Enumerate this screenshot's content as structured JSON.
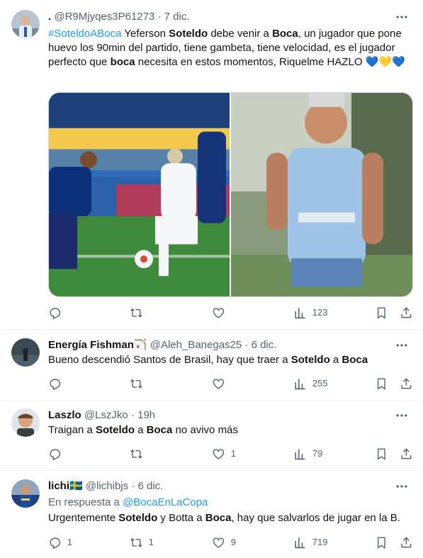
{
  "tweets": [
    {
      "name": ".",
      "handle": "@R9Mjyqes3P61273",
      "date": "7 dic.",
      "text_parts": [
        {
          "t": "#SoteldoABoca",
          "style": "link"
        },
        {
          "t": " Yeferson ",
          "style": "plain"
        },
        {
          "t": "Soteldo",
          "style": "bold"
        },
        {
          "t": " debe venir a ",
          "style": "plain"
        },
        {
          "t": "Boca",
          "style": "bold"
        },
        {
          "t": ", un jugador que pone huevo los 90min del partido, tiene gambeta, tiene velocidad, es el jugador perfecto que ",
          "style": "plain"
        },
        {
          "t": "boca",
          "style": "bold"
        },
        {
          "t": " necesita en estos momentos, Riquelme HAZLO ",
          "style": "plain"
        },
        {
          "t": "💙💛💙",
          "style": "emoji"
        }
      ],
      "replies": "",
      "retweets": "",
      "likes": "",
      "views": "123"
    },
    {
      "name": "Energía Fishman",
      "name_emoji": "🏹",
      "handle": "@Aleh_Banegas25",
      "date": "6 dic.",
      "text_parts": [
        {
          "t": "Bueno descendió Santos de Brasil, hay que traer a ",
          "style": "plain"
        },
        {
          "t": "Soteldo",
          "style": "bold"
        },
        {
          "t": " a ",
          "style": "plain"
        },
        {
          "t": "Boca",
          "style": "bold"
        }
      ],
      "replies": "",
      "retweets": "",
      "likes": "",
      "views": "255"
    },
    {
      "name": "Laszlo",
      "handle": "@LszJko",
      "date": "19h",
      "text_parts": [
        {
          "t": "Traigan a ",
          "style": "plain"
        },
        {
          "t": "Soteldo",
          "style": "bold"
        },
        {
          "t": " a ",
          "style": "plain"
        },
        {
          "t": "Boca",
          "style": "bold"
        },
        {
          "t": " no avivo más",
          "style": "plain"
        }
      ],
      "replies": "",
      "retweets": "",
      "likes": "1",
      "views": "79"
    },
    {
      "name": "lichi",
      "name_emoji": "🇸🇪",
      "handle": "@lichibjs",
      "date": "6 dic.",
      "reply_prefix": "En respuesta a ",
      "reply_to": "@BocaEnLaCopa",
      "text_parts": [
        {
          "t": "Urgentemente ",
          "style": "plain"
        },
        {
          "t": "Soteldo",
          "style": "bold"
        },
        {
          "t": " y Botta a ",
          "style": "plain"
        },
        {
          "t": "Boca",
          "style": "bold"
        },
        {
          "t": ", hay que salvarlos de jugar en la B.",
          "style": "plain"
        }
      ],
      "replies": "1",
      "retweets": "1",
      "likes": "9",
      "views": "719"
    }
  ],
  "separator": "·",
  "colors": {
    "link": "#1d9bf0",
    "text": "#0f1419",
    "secondary": "#536471",
    "border": "#eff3f4"
  },
  "icons": [
    "reply-icon",
    "retweet-icon",
    "like-icon",
    "views-icon",
    "bookmark-icon",
    "share-icon",
    "more-icon"
  ]
}
